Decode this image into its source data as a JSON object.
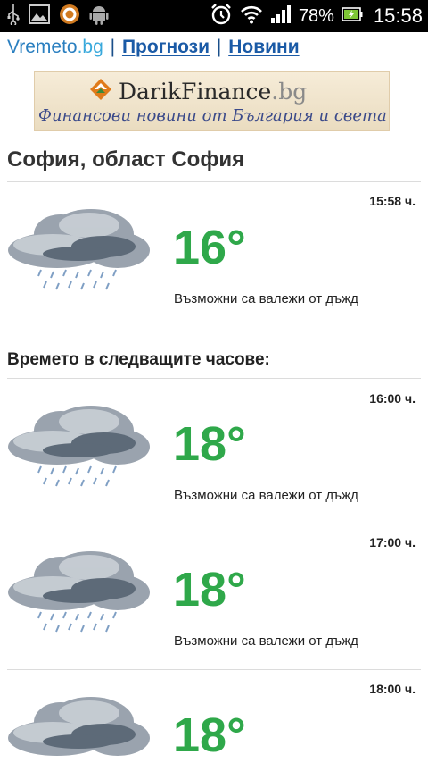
{
  "status_bar": {
    "battery": "78%",
    "time": "15:58",
    "icons": [
      "usb-icon",
      "image-icon",
      "app-icon",
      "android-icon",
      "alarm-icon",
      "wifi-icon",
      "signal-icon",
      "battery-icon"
    ]
  },
  "header": {
    "logo_main": "Vremeto",
    "logo_domain": ".bg",
    "separator": "|",
    "links": [
      "Прогнози",
      "Новини"
    ]
  },
  "banner": {
    "brand": "DarikFinance",
    "brand_domain": ".bg",
    "subtitle": "Финансови новини от България и света"
  },
  "location": {
    "title": "София, област София"
  },
  "current": {
    "time": "15:58 ч.",
    "temp": "16°",
    "desc": "Възможни са валежи от дъжд"
  },
  "hourly": {
    "title": "Времето в следващите часове:",
    "items": [
      {
        "time": "16:00 ч.",
        "temp": "18°",
        "desc": "Възможни са валежи от дъжд"
      },
      {
        "time": "17:00 ч.",
        "temp": "18°",
        "desc": "Възможни са валежи от дъжд"
      },
      {
        "time": "18:00 ч.",
        "temp": "18°",
        "desc": ""
      }
    ]
  },
  "colors": {
    "temp": "#2fa84a",
    "link": "#1a5aa6",
    "statusbar": "#000000"
  }
}
